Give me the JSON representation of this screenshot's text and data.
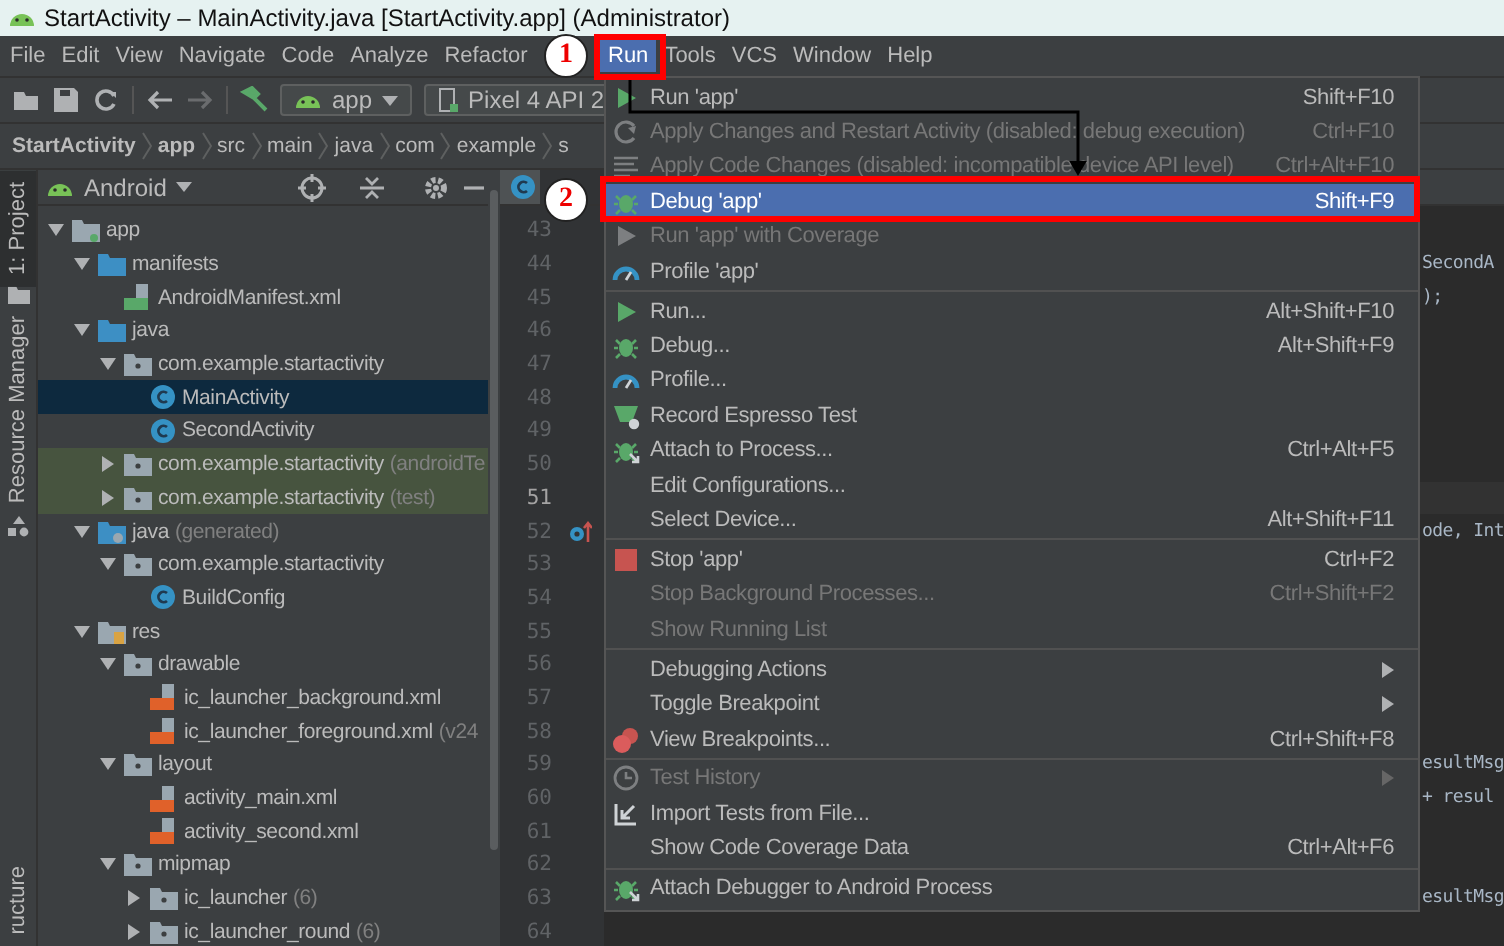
{
  "window": {
    "title": "StartActivity – MainActivity.java [StartActivity.app] (Administrator)"
  },
  "menu_bar": [
    {
      "label": "File",
      "selected": false
    },
    {
      "label": "Edit",
      "selected": false
    },
    {
      "label": "View",
      "selected": false
    },
    {
      "label": "Navigate",
      "selected": false
    },
    {
      "label": "Code",
      "selected": false
    },
    {
      "label": "Analyze",
      "selected": false
    },
    {
      "label": "Refactor",
      "selected": false
    },
    {
      "label": "Run",
      "selected": true
    },
    {
      "label": "Tools",
      "selected": false
    },
    {
      "label": "VCS",
      "selected": false
    },
    {
      "label": "Window",
      "selected": false
    },
    {
      "label": "Help",
      "selected": false
    }
  ],
  "toolbar": {
    "configuration": "app",
    "device": "Pixel 4 API 2"
  },
  "breadcrumb": [
    "StartActivity",
    "app",
    "src",
    "main",
    "java",
    "com",
    "example",
    "s"
  ],
  "tool_window_stripe": [
    {
      "label": "1: Project",
      "selected": true
    },
    {
      "label": "Resource Manager",
      "selected": false
    },
    {
      "label": "ructure",
      "selected": false
    }
  ],
  "project_panel": {
    "view": "Android",
    "tree": [
      {
        "label": "app",
        "kind": "module",
        "expanded": true,
        "selected": false,
        "test": false,
        "children": [
          {
            "label": "manifests",
            "kind": "folder",
            "expanded": true,
            "selected": false,
            "test": false,
            "children": [
              {
                "label": "AndroidManifest.xml",
                "kind": "manifest",
                "selected": false,
                "test": false
              }
            ]
          },
          {
            "label": "java",
            "kind": "folder",
            "expanded": true,
            "selected": false,
            "test": false,
            "children": [
              {
                "label": "com.example.startactivity",
                "kind": "package",
                "expanded": true,
                "selected": false,
                "test": false,
                "children": [
                  {
                    "label": "MainActivity",
                    "kind": "class",
                    "selected": true,
                    "test": false
                  },
                  {
                    "label": "SecondActivity",
                    "kind": "class",
                    "selected": false,
                    "test": false
                  }
                ]
              },
              {
                "label": "com.example.startactivity",
                "suffix": "(androidTe",
                "kind": "package",
                "expanded": false,
                "selected": false,
                "test": true
              },
              {
                "label": "com.example.startactivity",
                "suffix": "(test)",
                "kind": "package",
                "expanded": false,
                "selected": false,
                "test": true
              }
            ]
          },
          {
            "label": "java",
            "suffix": "(generated)",
            "kind": "generated",
            "expanded": true,
            "selected": false,
            "test": false,
            "children": [
              {
                "label": "com.example.startactivity",
                "kind": "package",
                "expanded": true,
                "selected": false,
                "test": false,
                "children": [
                  {
                    "label": "BuildConfig",
                    "kind": "class",
                    "selected": false,
                    "test": false
                  }
                ]
              }
            ]
          },
          {
            "label": "res",
            "kind": "resources",
            "expanded": true,
            "selected": false,
            "test": false,
            "children": [
              {
                "label": "drawable",
                "kind": "package",
                "expanded": true,
                "selected": false,
                "test": false,
                "children": [
                  {
                    "label": "ic_launcher_background.xml",
                    "kind": "xml",
                    "selected": false,
                    "test": false
                  },
                  {
                    "label": "ic_launcher_foreground.xml",
                    "suffix": "(v24",
                    "kind": "xml",
                    "selected": false,
                    "test": false
                  }
                ]
              },
              {
                "label": "layout",
                "kind": "package",
                "expanded": true,
                "selected": false,
                "test": false,
                "children": [
                  {
                    "label": "activity_main.xml",
                    "kind": "xml",
                    "selected": false,
                    "test": false
                  },
                  {
                    "label": "activity_second.xml",
                    "kind": "xml",
                    "selected": false,
                    "test": false
                  }
                ]
              },
              {
                "label": "mipmap",
                "kind": "package",
                "expanded": true,
                "selected": false,
                "test": false,
                "children": [
                  {
                    "label": "ic_launcher",
                    "suffix": "(6)",
                    "kind": "package",
                    "expanded": false,
                    "selected": false,
                    "test": false
                  },
                  {
                    "label": "ic_launcher_round",
                    "suffix": "(6)",
                    "kind": "package",
                    "expanded": false,
                    "selected": false,
                    "test": false
                  }
                ]
              }
            ]
          }
        ]
      }
    ]
  },
  "editor": {
    "lines": [
      {
        "number": "43",
        "current": false
      },
      {
        "number": "44",
        "current": false,
        "code": "SecondA"
      },
      {
        "number": "45",
        "current": false,
        "code": ");"
      },
      {
        "number": "46",
        "current": false
      },
      {
        "number": "47",
        "current": false
      },
      {
        "number": "48",
        "current": false
      },
      {
        "number": "49",
        "current": false
      },
      {
        "number": "50",
        "current": false
      },
      {
        "number": "51",
        "current": true
      },
      {
        "number": "52",
        "current": false,
        "override": true,
        "code": "ode, Int"
      },
      {
        "number": "53",
        "current": false
      },
      {
        "number": "54",
        "current": false
      },
      {
        "number": "55",
        "current": false
      },
      {
        "number": "56",
        "current": false
      },
      {
        "number": "57",
        "current": false
      },
      {
        "number": "58",
        "current": false
      },
      {
        "number": "59",
        "current": false,
        "code": "esultMsg"
      },
      {
        "number": "60",
        "current": false,
        "code": "+ resul"
      },
      {
        "number": "61",
        "current": false
      },
      {
        "number": "62",
        "current": false
      },
      {
        "number": "63",
        "current": false,
        "code": "esultMsg"
      },
      {
        "number": "64",
        "current": false
      }
    ]
  },
  "run_menu": {
    "items": [
      {
        "kind": "item",
        "label": "Run 'app'",
        "shortcut": "Shift+F10",
        "disabled": false,
        "selected": false
      },
      {
        "kind": "item",
        "label": "Apply Changes and Restart Activity (disabled: debug execution)",
        "shortcut": "Ctrl+F10",
        "disabled": true,
        "selected": false
      },
      {
        "kind": "item",
        "label": "Apply Code Changes (disabled: incompatible device API level)",
        "shortcut": "Ctrl+Alt+F10",
        "disabled": true,
        "selected": false
      },
      {
        "kind": "item",
        "label": "Debug 'app'",
        "shortcut": "Shift+F9",
        "disabled": false,
        "selected": true
      },
      {
        "kind": "item",
        "label": "Run 'app' with Coverage",
        "disabled": true,
        "selected": false
      },
      {
        "kind": "item",
        "label": "Profile 'app'",
        "disabled": false,
        "selected": false
      },
      {
        "kind": "separator"
      },
      {
        "kind": "item",
        "label": "Run...",
        "shortcut": "Alt+Shift+F10",
        "disabled": false,
        "selected": false
      },
      {
        "kind": "item",
        "label": "Debug...",
        "shortcut": "Alt+Shift+F9",
        "disabled": false,
        "selected": false
      },
      {
        "kind": "item",
        "label": "Profile...",
        "disabled": false,
        "selected": false
      },
      {
        "kind": "item",
        "label": "Record Espresso Test",
        "disabled": false,
        "selected": false
      },
      {
        "kind": "item",
        "label": "Attach to Process...",
        "shortcut": "Ctrl+Alt+F5",
        "disabled": false,
        "selected": false
      },
      {
        "kind": "item",
        "label": "Edit Configurations...",
        "disabled": false,
        "selected": false
      },
      {
        "kind": "item",
        "label": "Select Device...",
        "shortcut": "Alt+Shift+F11",
        "disabled": false,
        "selected": false
      },
      {
        "kind": "separator"
      },
      {
        "kind": "item",
        "label": "Stop 'app'",
        "shortcut": "Ctrl+F2",
        "disabled": false,
        "selected": false
      },
      {
        "kind": "item",
        "label": "Stop Background Processes...",
        "shortcut": "Ctrl+Shift+F2",
        "disabled": true,
        "selected": false
      },
      {
        "kind": "item",
        "label": "Show Running List",
        "disabled": true,
        "selected": false
      },
      {
        "kind": "separator"
      },
      {
        "kind": "submenu",
        "label": "Debugging Actions",
        "disabled": false,
        "selected": false
      },
      {
        "kind": "submenu",
        "label": "Toggle Breakpoint",
        "disabled": false,
        "selected": false
      },
      {
        "kind": "item",
        "label": "View Breakpoints...",
        "shortcut": "Ctrl+Shift+F8",
        "disabled": false,
        "selected": false
      },
      {
        "kind": "separator"
      },
      {
        "kind": "submenu",
        "label": "Test History",
        "disabled": true,
        "selected": false
      },
      {
        "kind": "item",
        "label": "Import Tests from File...",
        "disabled": false,
        "selected": false
      },
      {
        "kind": "item",
        "label": "Show Code Coverage Data",
        "shortcut": "Ctrl+Alt+F6",
        "disabled": false,
        "selected": false
      },
      {
        "kind": "separator"
      },
      {
        "kind": "item",
        "label": "Attach Debugger to Android Process",
        "disabled": false,
        "selected": false
      }
    ]
  },
  "annotations": [
    {
      "number": "1"
    },
    {
      "number": "2"
    }
  ]
}
